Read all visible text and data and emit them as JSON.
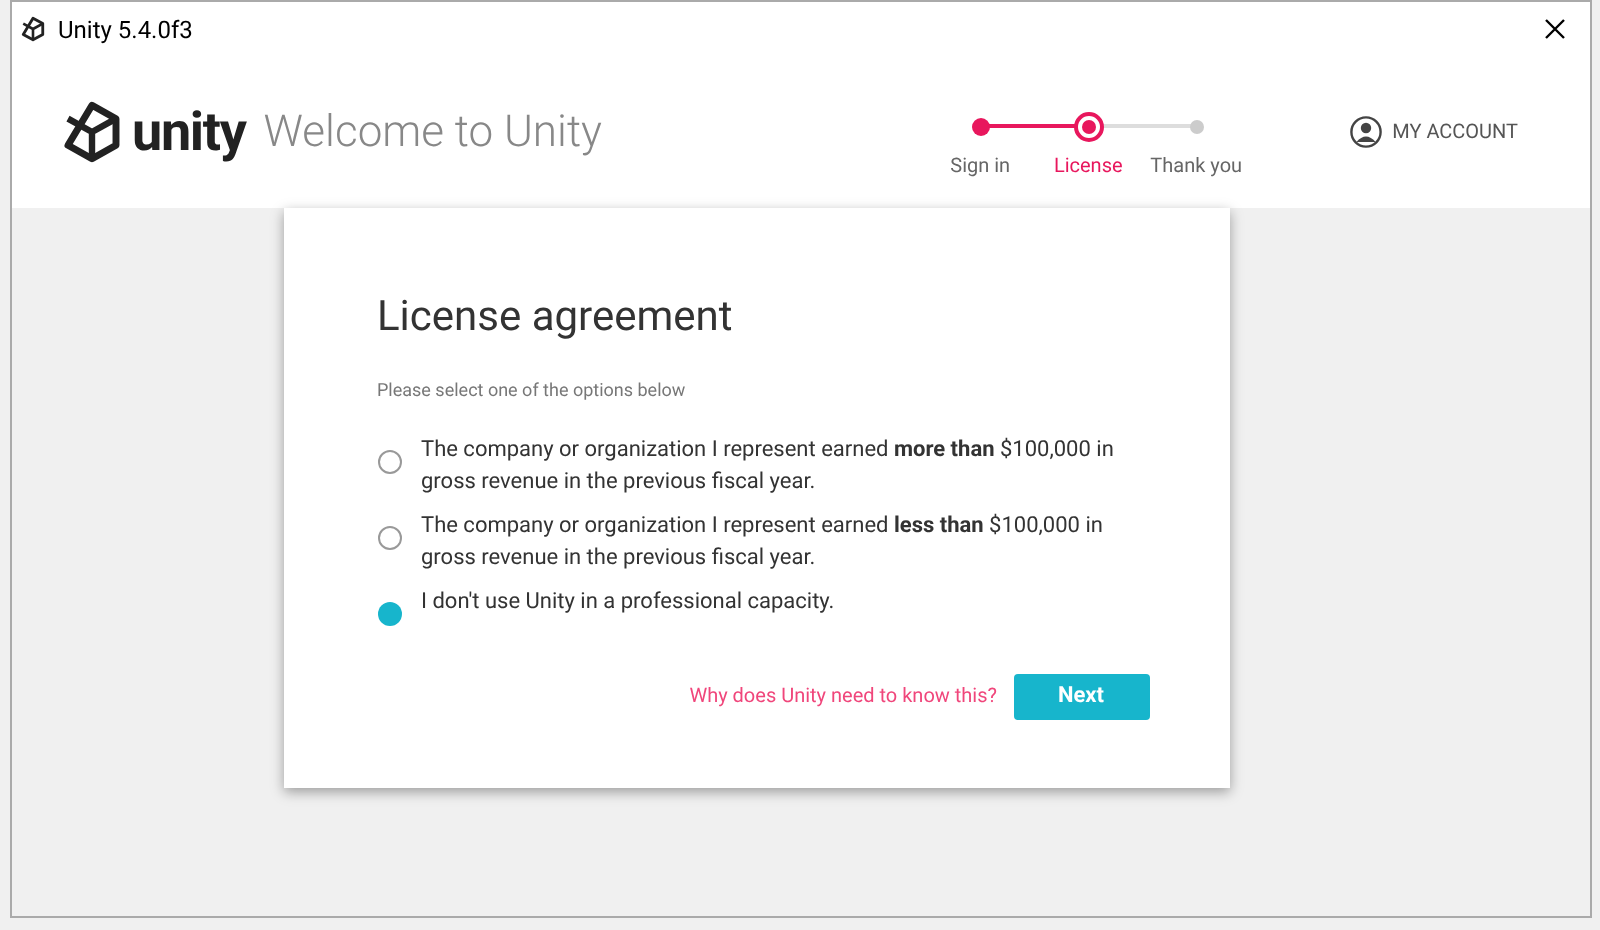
{
  "window": {
    "title": "Unity 5.4.0f3"
  },
  "header": {
    "logo_text": "unity",
    "heading": "Welcome to Unity"
  },
  "steps": [
    {
      "label": "Sign in",
      "selected": false,
      "completed": true
    },
    {
      "label": "License",
      "selected": true,
      "completed": false
    },
    {
      "label": "Thank you",
      "selected": false,
      "completed": false
    }
  ],
  "account": {
    "label": "MY ACCOUNT"
  },
  "card": {
    "title": "License agreement",
    "subtitle": "Please select one of the options below",
    "options": [
      {
        "text": "The company or organization I represent earned **more than** $100,000 in gross revenue in the previous fiscal year.",
        "selected": false
      },
      {
        "text": "The company or organization I represent earned **less than** $100,000 in gross revenue in the previous fiscal year.",
        "selected": false
      },
      {
        "text": "I don't use Unity in a professional capacity.",
        "selected": true
      }
    ],
    "help_link": "Why does Unity need to know this?",
    "next_button": "Next"
  }
}
